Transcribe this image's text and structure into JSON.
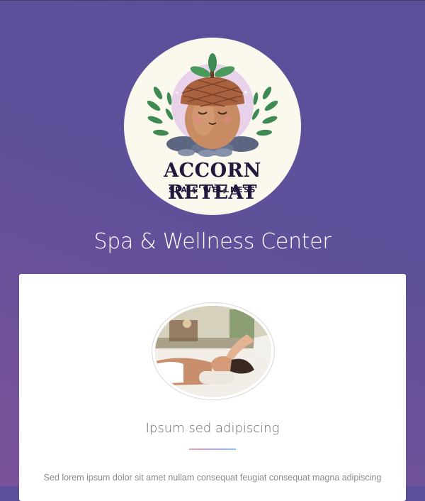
{
  "logo": {
    "name": "ACCORN RETEAT",
    "tagline": "SPA & WELLNESS"
  },
  "header": {
    "title": "Spa & Wellness Center"
  },
  "feature_card": {
    "image_icon": "massage-photo",
    "heading": "Ipsum sed adipiscing",
    "body": "Sed lorem ipsum dolor sit amet nullam consequat feugiat consequat magna adipiscing"
  },
  "colors": {
    "background": "#5f509a",
    "card": "#ffffff",
    "title_text": "#ffffff",
    "heading_text": "#6b6b6b"
  }
}
